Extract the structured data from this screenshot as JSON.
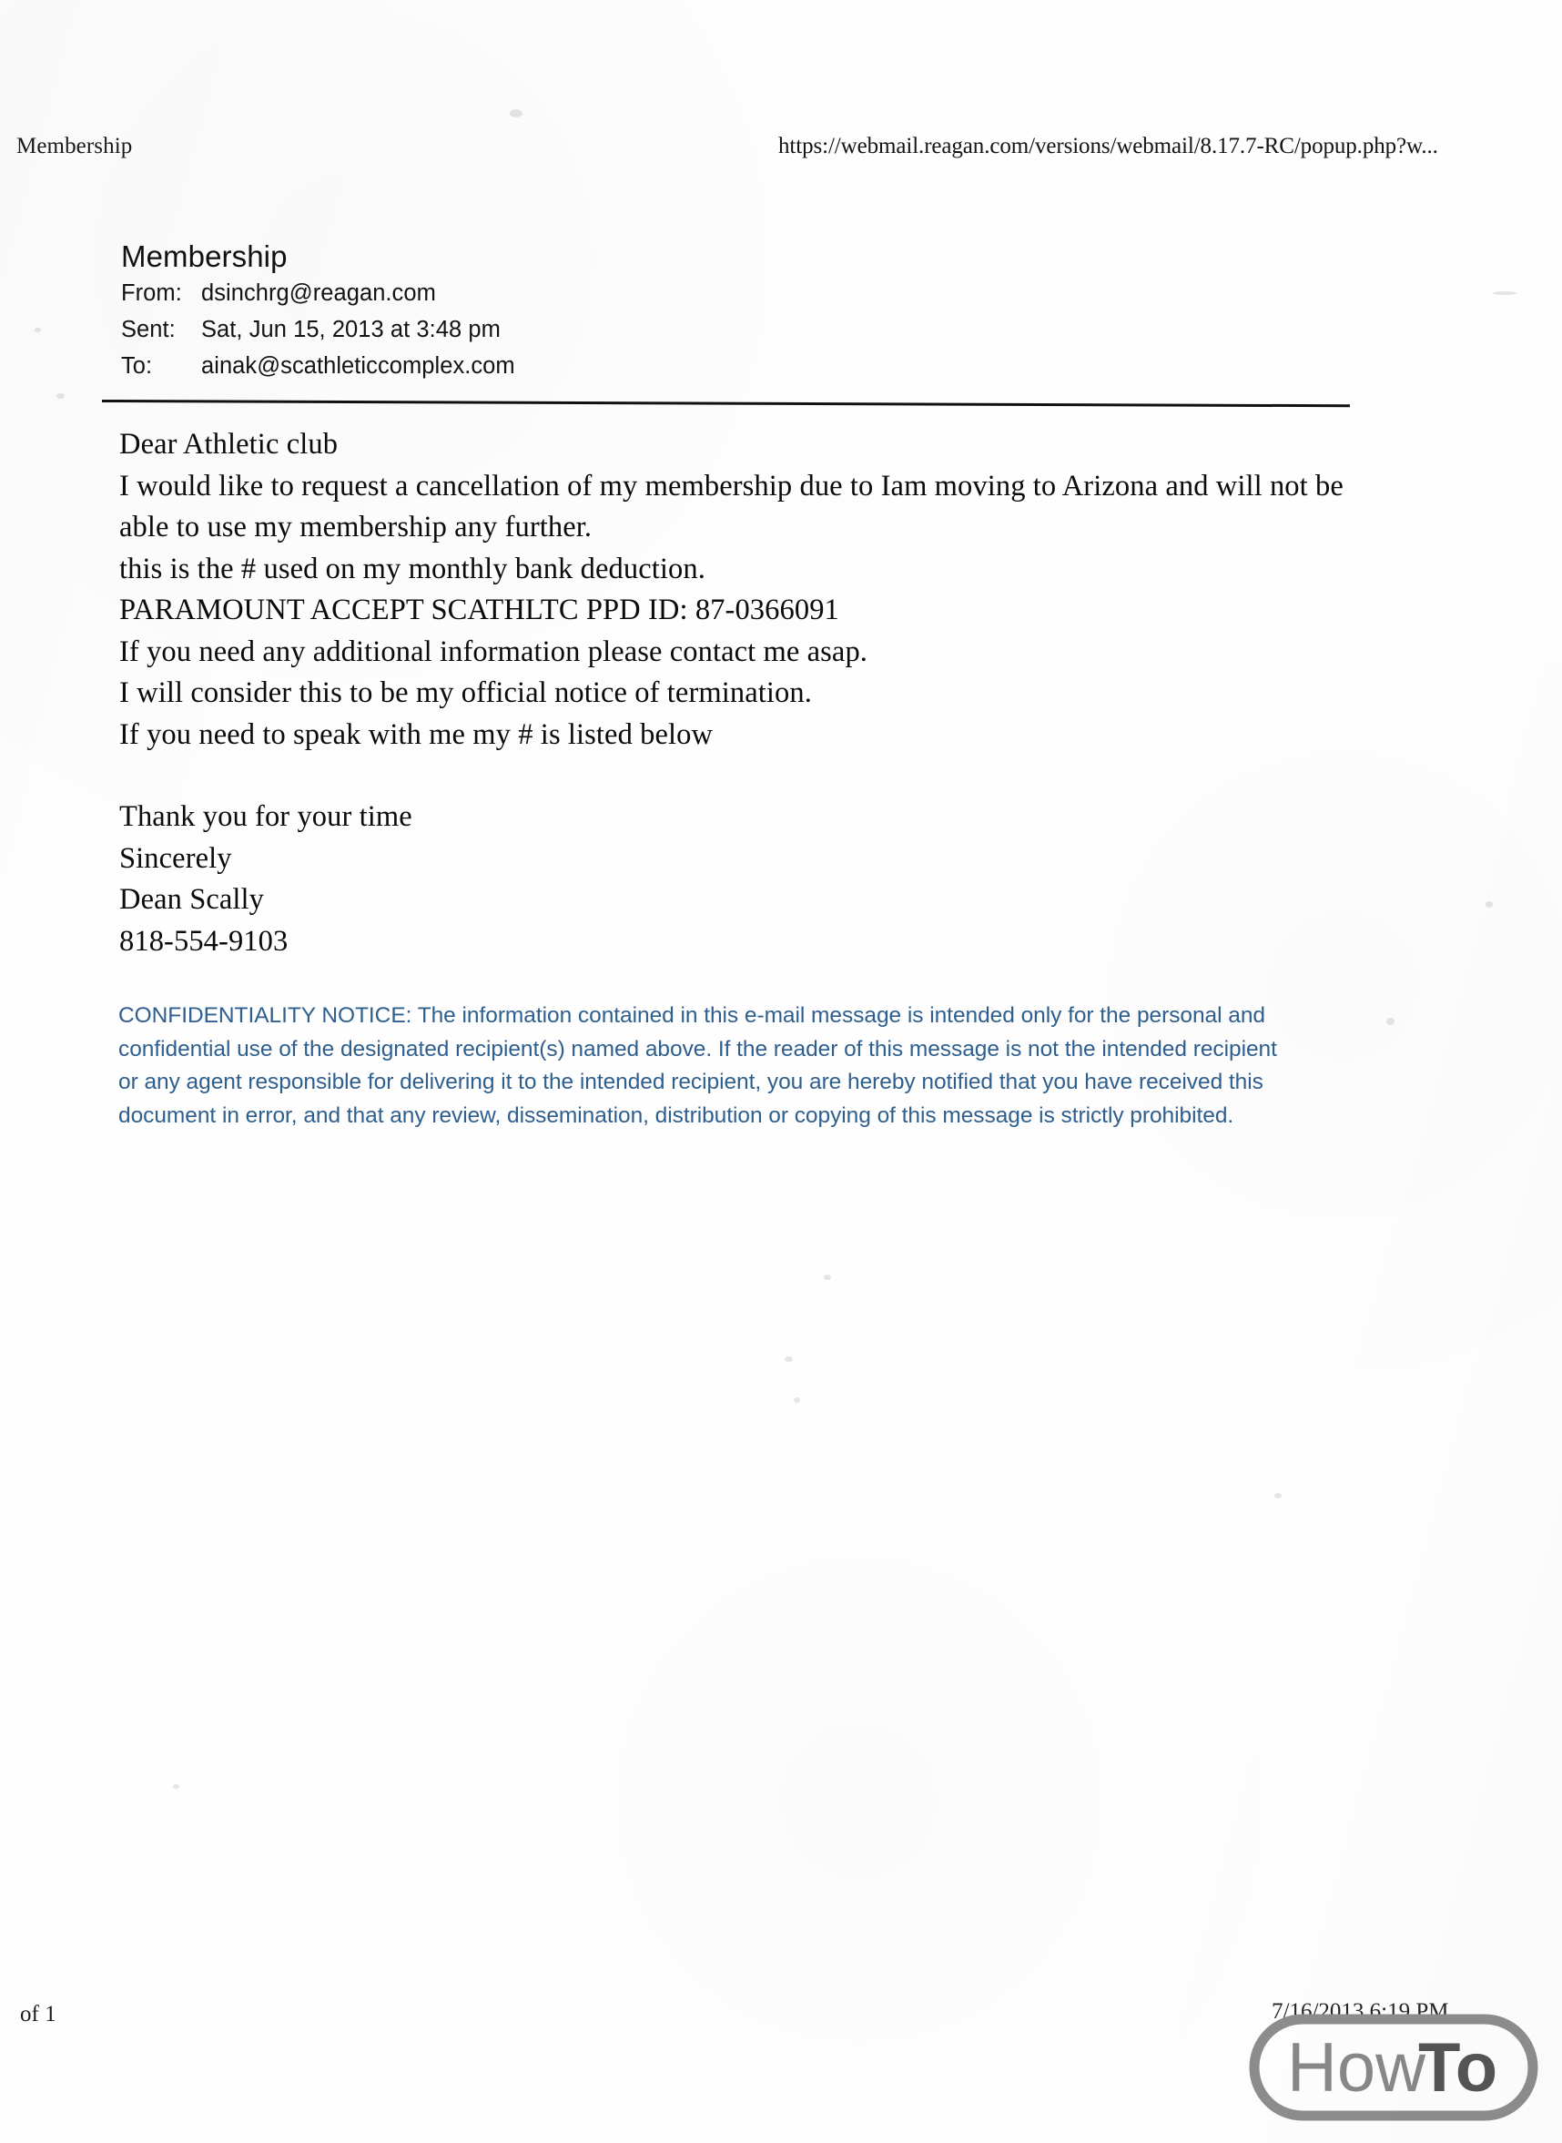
{
  "print_header": {
    "title": "Membership",
    "url": "https://webmail.reagan.com/versions/webmail/8.17.7-RC/popup.php?w..."
  },
  "email": {
    "subject": "Membership",
    "fields": [
      {
        "label": "From:",
        "value": "dsinchrg@reagan.com"
      },
      {
        "label": "Sent:",
        "value": "Sat, Jun 15, 2013 at 3:48 pm"
      },
      {
        "label": "To:",
        "value": "ainak@scathleticcomplex.com"
      }
    ],
    "body": [
      "Dear Athletic club",
      "I would like to request a cancellation of my membership due to Iam moving to Arizona and will not be able to use my membership any further.",
      "this is the # used on my monthly bank deduction.",
      "PARAMOUNT ACCEPT SCATHLTC PPD ID: 87-0366091",
      "If you need any additional information please contact me asap.",
      "I will consider this to be my official notice of termination.",
      "If you need to speak with me my # is listed below"
    ],
    "signoff": [
      "Thank you for your time",
      "Sincerely",
      "Dean Scally",
      "818-554-9103"
    ],
    "confidentiality_notice": "CONFIDENTIALITY NOTICE: The information contained in this e-mail message is intended only for the personal and confidential use of the designated recipient(s) named above. If the reader of this message is not the intended recipient or any agent responsible for delivering it to the intended recipient, you are hereby notified that you have received this document in error, and that any review, dissemination, distribution or copying of this message is strictly prohibited."
  },
  "print_footer": {
    "page": "of 1",
    "timestamp": "7/16/2013 6:19 PM"
  },
  "watermark": {
    "text_primary": "How",
    "text_secondary": "To",
    "color_primary": "#888888",
    "color_secondary": "#555555"
  },
  "colors": {
    "paper": "#fefefe",
    "ink": "#0d0d0d",
    "notice_blue": "#2f5f8f",
    "rule": "#111111"
  }
}
